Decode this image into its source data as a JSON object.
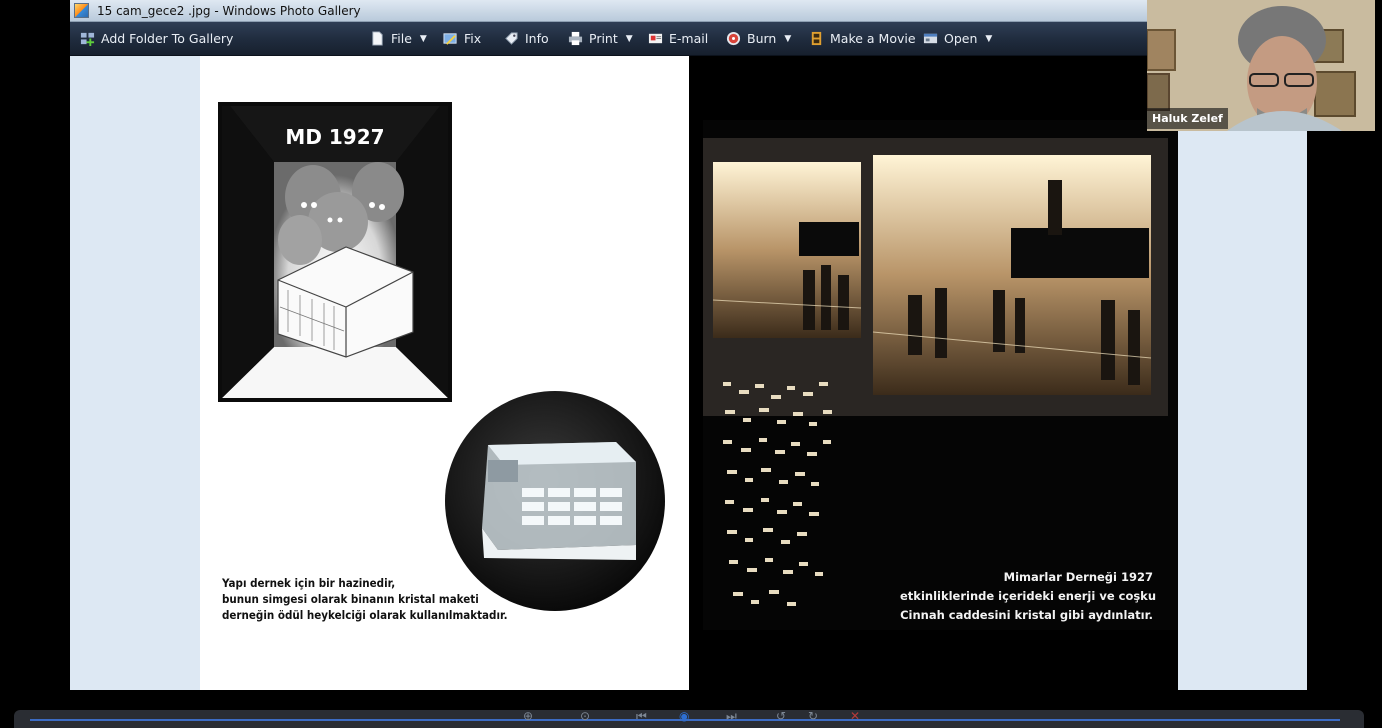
{
  "window": {
    "title": "15 cam_gece2 .jpg - Windows Photo Gallery"
  },
  "toolbar": {
    "add_folder": "Add Folder To Gallery",
    "file": "File",
    "fix": "Fix",
    "info": "Info",
    "print": "Print",
    "email": "E-mail",
    "burn": "Burn",
    "make_movie": "Make a Movie",
    "open": "Open"
  },
  "photo": {
    "comic_title": "MD 1927",
    "caption_left": [
      "Yapı dernek için bir hazinedir,",
      "bunun simgesi olarak binanın kristal maketi",
      "derneğin ödül heykelciği olarak kullanılmaktadır."
    ],
    "caption_right": [
      "Mimarlar Derneği 1927",
      "etkinliklerinde içerideki enerji ve coşku",
      "Cinnah caddesini kristal gibi aydınlatır."
    ]
  },
  "participant": {
    "name": "Haluk Zelef"
  }
}
